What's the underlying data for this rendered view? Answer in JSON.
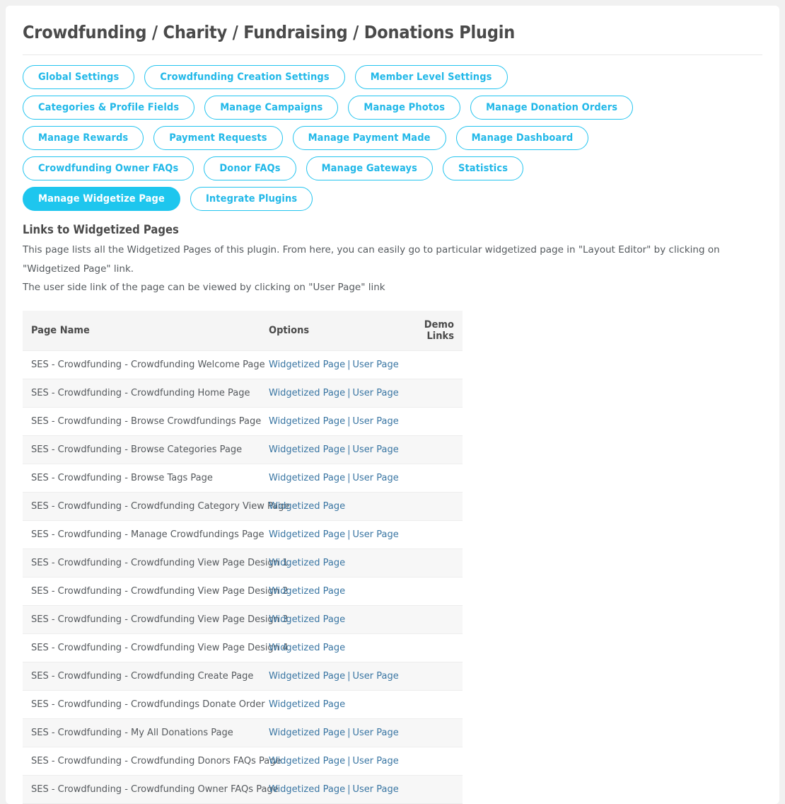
{
  "page": {
    "title": "Crowdfunding / Charity / Fundraising / Donations Plugin",
    "accent_color": "#1ec6ee",
    "link_color": "#3a76a3",
    "background_color": "#f1f1f1",
    "card_color": "#ffffff"
  },
  "tabs": [
    {
      "label": "Global Settings",
      "active": false
    },
    {
      "label": "Crowdfunding Creation Settings",
      "active": false
    },
    {
      "label": "Member Level Settings",
      "active": false
    },
    {
      "label": "Categories & Profile Fields",
      "active": false
    },
    {
      "label": "Manage Campaigns",
      "active": false
    },
    {
      "label": "Manage Photos",
      "active": false
    },
    {
      "label": "Manage Donation Orders",
      "active": false
    },
    {
      "label": "Manage Rewards",
      "active": false
    },
    {
      "label": "Payment Requests",
      "active": false
    },
    {
      "label": "Manage Payment Made",
      "active": false
    },
    {
      "label": "Manage Dashboard",
      "active": false
    },
    {
      "label": "Crowdfunding Owner FAQs",
      "active": false
    },
    {
      "label": "Donor FAQs",
      "active": false
    },
    {
      "label": "Manage Gateways",
      "active": false
    },
    {
      "label": "Statistics",
      "active": false
    },
    {
      "label": "Manage Widgetize Page",
      "active": true
    },
    {
      "label": "Integrate Plugins",
      "active": false
    }
  ],
  "section": {
    "heading": "Links to Widgetized Pages",
    "description_line1": "This page lists all the Widgetized Pages of this plugin. From here, you can easily go to particular widgetized page in \"Layout Editor\" by clicking on \"Widgetized Page\" link.",
    "description_line2": "The user side link of the page can be viewed by clicking on \"User Page\" link"
  },
  "table": {
    "columns": [
      "Page Name",
      "Options",
      "Demo Links"
    ],
    "link_labels": {
      "widgetized": "Widgetized Page",
      "user": "User Page",
      "separator": "|"
    },
    "rows": [
      {
        "name": "SES - Crowdfunding - Crowdfunding Welcome Page",
        "widgetized": "Widgetized Page",
        "user": "User Page",
        "demo": ""
      },
      {
        "name": "SES - Crowdfunding - Crowdfunding Home Page",
        "widgetized": "Widgetized Page",
        "user": "User Page",
        "demo": ""
      },
      {
        "name": "SES - Crowdfunding - Browse Crowdfundings Page",
        "widgetized": "Widgetized Page",
        "user": "User Page",
        "demo": ""
      },
      {
        "name": "SES - Crowdfunding - Browse Categories Page",
        "widgetized": "Widgetized Page",
        "user": "User Page",
        "demo": ""
      },
      {
        "name": "SES - Crowdfunding - Browse Tags Page",
        "widgetized": "Widgetized Page",
        "user": "User Page",
        "demo": ""
      },
      {
        "name": "SES - Crowdfunding - Crowdfunding Category View Page",
        "widgetized": "Widgetized Page",
        "user": "",
        "demo": ""
      },
      {
        "name": "SES - Crowdfunding - Manage Crowdfundings Page",
        "widgetized": "Widgetized Page",
        "user": "User Page",
        "demo": ""
      },
      {
        "name": "SES - Crowdfunding - Crowdfunding View Page Design 1",
        "widgetized": "Widgetized Page",
        "user": "",
        "demo": ""
      },
      {
        "name": "SES - Crowdfunding - Crowdfunding View Page Design 2",
        "widgetized": "Widgetized Page",
        "user": "",
        "demo": ""
      },
      {
        "name": "SES - Crowdfunding - Crowdfunding View Page Design 3",
        "widgetized": "Widgetized Page",
        "user": "",
        "demo": ""
      },
      {
        "name": "SES - Crowdfunding - Crowdfunding View Page Design 4",
        "widgetized": "Widgetized Page",
        "user": "",
        "demo": ""
      },
      {
        "name": "SES - Crowdfunding - Crowdfunding Create Page",
        "widgetized": "Widgetized Page",
        "user": "User Page",
        "demo": ""
      },
      {
        "name": "SES - Crowdfunding - Crowdfundings Donate Order",
        "widgetized": "Widgetized Page",
        "user": "",
        "demo": ""
      },
      {
        "name": "SES - Crowdfunding - My All Donations Page",
        "widgetized": "Widgetized Page",
        "user": "User Page",
        "demo": ""
      },
      {
        "name": "SES - Crowdfunding - Crowdfunding Donors FAQs Page",
        "widgetized": "Widgetized Page",
        "user": "User Page",
        "demo": ""
      },
      {
        "name": "SES - Crowdfunding - Crowdfunding Owner FAQs Page",
        "widgetized": "Widgetized Page",
        "user": "User Page",
        "demo": ""
      }
    ]
  }
}
